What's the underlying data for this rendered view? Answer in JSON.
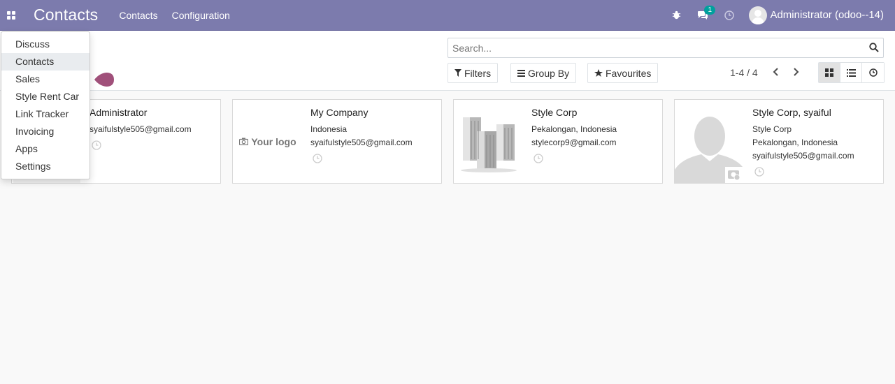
{
  "navbar": {
    "brand": "Contacts",
    "menu": [
      "Contacts",
      "Configuration"
    ],
    "messages_badge": "1",
    "user": "Administrator (odoo--14)",
    "color": "#7c7bad"
  },
  "control_panel": {
    "search_placeholder": "Search...",
    "filters_label": "Filters",
    "group_by_label": "Group By",
    "favourites_label": "Favourites",
    "pager": "1-4 / 4",
    "views": [
      "kanban-icon",
      "list-icon",
      "activity-icon"
    ]
  },
  "apps_menu": {
    "items": [
      "Discuss",
      "Contacts",
      "Sales",
      "Style Rent Car",
      "Link Tracker",
      "Invoicing",
      "Apps",
      "Settings"
    ],
    "active": "Contacts"
  },
  "cards": [
    {
      "title": "Administrator",
      "lines": [
        "syaifulstyle505@gmail.com"
      ]
    },
    {
      "title": "My Company",
      "image_text": "Your logo",
      "lines": [
        "Indonesia",
        "syaifulstyle505@gmail.com"
      ]
    },
    {
      "title": "Style Corp",
      "lines": [
        "Pekalongan, Indonesia",
        "stylecorp9@gmail.com"
      ]
    },
    {
      "title": "Style Corp, syaiful",
      "lines": [
        "Style Corp",
        "Pekalongan, Indonesia",
        "syaifulstyle505@gmail.com"
      ]
    }
  ]
}
